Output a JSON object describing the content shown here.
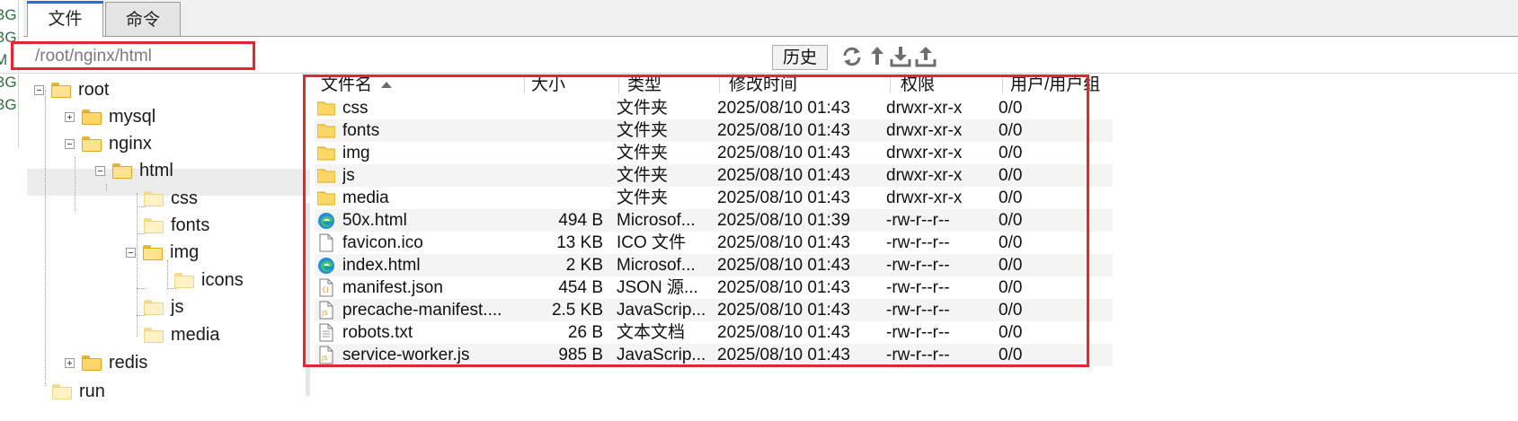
{
  "left_strip": [
    "BG",
    "BG",
    "M",
    "BG",
    "BG"
  ],
  "tabs": [
    {
      "label": "文件",
      "active": true
    },
    {
      "label": "命令",
      "active": false
    }
  ],
  "path": {
    "value": "/root/nginx/html"
  },
  "toolbar": {
    "history_label": "历史",
    "icons": [
      "refresh-icon",
      "upload-arrow-icon",
      "download-icon",
      "upload-icon"
    ]
  },
  "tree": [
    {
      "label": "root",
      "expander": "minus"
    },
    {
      "label": "mysql",
      "expander": "plus"
    },
    {
      "label": "nginx",
      "expander": "minus"
    },
    {
      "label": "html",
      "expander": "minus",
      "selected": true
    },
    {
      "label": "css"
    },
    {
      "label": "fonts"
    },
    {
      "label": "img",
      "expander": "minus"
    },
    {
      "label": "icons"
    },
    {
      "label": "js"
    },
    {
      "label": "media"
    },
    {
      "label": "redis",
      "expander": "plus"
    },
    {
      "label": "run"
    }
  ],
  "columns": [
    {
      "label": "文件名",
      "sorted": "asc"
    },
    {
      "label": "大小"
    },
    {
      "label": "类型"
    },
    {
      "label": "修改时间"
    },
    {
      "label": "权限"
    },
    {
      "label": "用户/用户组"
    }
  ],
  "files": [
    {
      "name": "css",
      "size": "",
      "type": "文件夹",
      "modified": "2025/08/10 01:43",
      "perm": "drwxr-xr-x",
      "owner": "0/0",
      "icon": "folder-icon"
    },
    {
      "name": "fonts",
      "size": "",
      "type": "文件夹",
      "modified": "2025/08/10 01:43",
      "perm": "drwxr-xr-x",
      "owner": "0/0",
      "icon": "folder-icon"
    },
    {
      "name": "img",
      "size": "",
      "type": "文件夹",
      "modified": "2025/08/10 01:43",
      "perm": "drwxr-xr-x",
      "owner": "0/0",
      "icon": "folder-icon"
    },
    {
      "name": "js",
      "size": "",
      "type": "文件夹",
      "modified": "2025/08/10 01:43",
      "perm": "drwxr-xr-x",
      "owner": "0/0",
      "icon": "folder-icon"
    },
    {
      "name": "media",
      "size": "",
      "type": "文件夹",
      "modified": "2025/08/10 01:43",
      "perm": "drwxr-xr-x",
      "owner": "0/0",
      "icon": "folder-icon"
    },
    {
      "name": "50x.html",
      "size": "494 B",
      "type": "Microsof...",
      "modified": "2025/08/10 01:39",
      "perm": "-rw-r--r--",
      "owner": "0/0",
      "icon": "edge-html-icon"
    },
    {
      "name": "favicon.ico",
      "size": "13 KB",
      "type": "ICO 文件",
      "modified": "2025/08/10 01:43",
      "perm": "-rw-r--r--",
      "owner": "0/0",
      "icon": "blank-file-icon"
    },
    {
      "name": "index.html",
      "size": "2 KB",
      "type": "Microsof...",
      "modified": "2025/08/10 01:43",
      "perm": "-rw-r--r--",
      "owner": "0/0",
      "icon": "edge-html-icon"
    },
    {
      "name": "manifest.json",
      "size": "454 B",
      "type": "JSON 源...",
      "modified": "2025/08/10 01:43",
      "perm": "-rw-r--r--",
      "owner": "0/0",
      "icon": "json-file-icon"
    },
    {
      "name": "precache-manifest....",
      "size": "2.5 KB",
      "type": "JavaScrip...",
      "modified": "2025/08/10 01:43",
      "perm": "-rw-r--r--",
      "owner": "0/0",
      "icon": "js-file-icon"
    },
    {
      "name": "robots.txt",
      "size": "26 B",
      "type": "文本文档",
      "modified": "2025/08/10 01:43",
      "perm": "-rw-r--r--",
      "owner": "0/0",
      "icon": "text-file-icon"
    },
    {
      "name": "service-worker.js",
      "size": "985 B",
      "type": "JavaScrip...",
      "modified": "2025/08/10 01:43",
      "perm": "-rw-r--r--",
      "owner": "0/0",
      "icon": "js-file-icon"
    }
  ],
  "colors": {
    "highlight_red": "#e6262b",
    "folder_yellow": "#ffd766",
    "active_tab_accent": "#2d6bd6"
  }
}
